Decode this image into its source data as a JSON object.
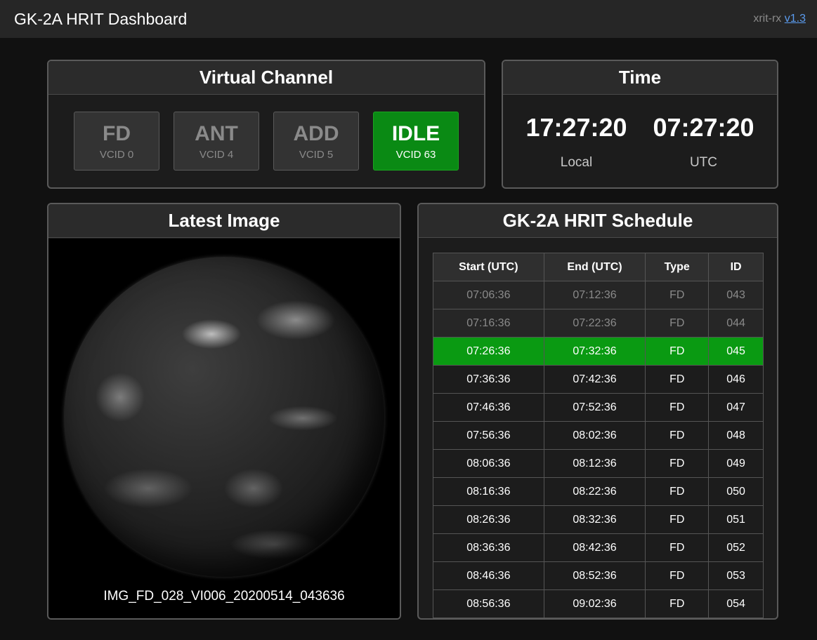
{
  "header": {
    "title": "GK-2A HRIT Dashboard",
    "version_prefix": "xrit-rx",
    "version_link": "v1.3"
  },
  "virtual_channel": {
    "title": "Virtual Channel",
    "channels": [
      {
        "name": "FD",
        "vcid": "VCID 0",
        "active": false
      },
      {
        "name": "ANT",
        "vcid": "VCID 4",
        "active": false
      },
      {
        "name": "ADD",
        "vcid": "VCID 5",
        "active": false
      },
      {
        "name": "IDLE",
        "vcid": "VCID 63",
        "active": true
      }
    ]
  },
  "time": {
    "title": "Time",
    "local_value": "17:27:20",
    "local_label": "Local",
    "utc_value": "07:27:20",
    "utc_label": "UTC"
  },
  "latest_image": {
    "title": "Latest Image",
    "filename": "IMG_FD_028_VI006_20200514_043636"
  },
  "schedule": {
    "title": "GK-2A HRIT Schedule",
    "columns": [
      "Start (UTC)",
      "End (UTC)",
      "Type",
      "ID"
    ],
    "rows": [
      {
        "start": "07:06:36",
        "end": "07:12:36",
        "type": "FD",
        "id": "043",
        "state": "past"
      },
      {
        "start": "07:16:36",
        "end": "07:22:36",
        "type": "FD",
        "id": "044",
        "state": "past"
      },
      {
        "start": "07:26:36",
        "end": "07:32:36",
        "type": "FD",
        "id": "045",
        "state": "current"
      },
      {
        "start": "07:36:36",
        "end": "07:42:36",
        "type": "FD",
        "id": "046",
        "state": "future"
      },
      {
        "start": "07:46:36",
        "end": "07:52:36",
        "type": "FD",
        "id": "047",
        "state": "future"
      },
      {
        "start": "07:56:36",
        "end": "08:02:36",
        "type": "FD",
        "id": "048",
        "state": "future"
      },
      {
        "start": "08:06:36",
        "end": "08:12:36",
        "type": "FD",
        "id": "049",
        "state": "future"
      },
      {
        "start": "08:16:36",
        "end": "08:22:36",
        "type": "FD",
        "id": "050",
        "state": "future"
      },
      {
        "start": "08:26:36",
        "end": "08:32:36",
        "type": "FD",
        "id": "051",
        "state": "future"
      },
      {
        "start": "08:36:36",
        "end": "08:42:36",
        "type": "FD",
        "id": "052",
        "state": "future"
      },
      {
        "start": "08:46:36",
        "end": "08:52:36",
        "type": "FD",
        "id": "053",
        "state": "future"
      },
      {
        "start": "08:56:36",
        "end": "09:02:36",
        "type": "FD",
        "id": "054",
        "state": "future"
      }
    ]
  },
  "colors": {
    "background": "#111111",
    "panel": "#1c1c1c",
    "active_green": "#0a9a12",
    "link_blue": "#5b9cf0"
  }
}
